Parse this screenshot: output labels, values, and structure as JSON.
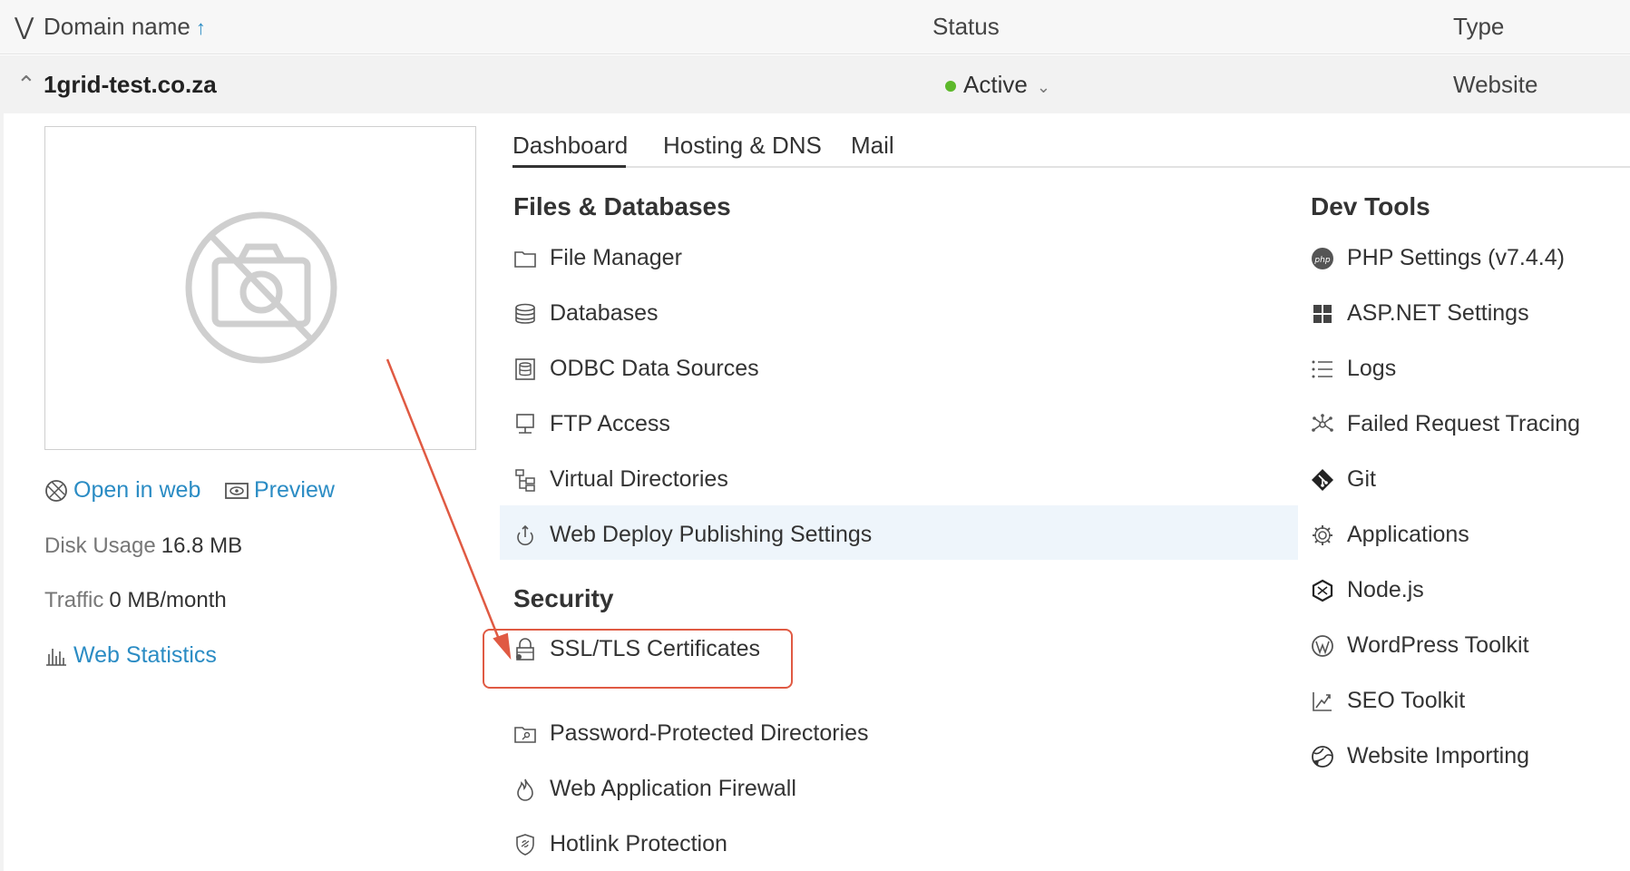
{
  "table_header": {
    "domain_name": "Domain name",
    "sort_icon": "arrow-up-icon",
    "status": "Status",
    "type": "Type"
  },
  "domain": {
    "name": "1grid-test.co.za",
    "status": "Active",
    "status_color": "#5cb82a",
    "type": "Website"
  },
  "left_panel": {
    "open_in_web": "Open in web",
    "preview": "Preview",
    "disk_usage_label": "Disk Usage",
    "disk_usage_value": "16.8 MB",
    "traffic_label": "Traffic",
    "traffic_value": "0 MB/month",
    "web_statistics": "Web Statistics"
  },
  "tabs": [
    {
      "label": "Dashboard",
      "active": true
    },
    {
      "label": "Hosting & DNS",
      "active": false
    },
    {
      "label": "Mail",
      "active": false
    }
  ],
  "files_databases": {
    "title": "Files & Databases",
    "items": [
      {
        "label": "File Manager",
        "icon": "folder-icon"
      },
      {
        "label": "Databases",
        "icon": "database-icon"
      },
      {
        "label": "ODBC Data Sources",
        "icon": "odbc-icon"
      },
      {
        "label": "FTP Access",
        "icon": "ftp-icon"
      },
      {
        "label": "Virtual Directories",
        "icon": "directories-icon"
      },
      {
        "label": "Web Deploy Publishing Settings",
        "icon": "web-deploy-icon"
      }
    ]
  },
  "security": {
    "title": "Security",
    "items": [
      {
        "label": "SSL/TLS Certificates",
        "icon": "lock-icon"
      },
      {
        "label": "Password-Protected Directories",
        "icon": "protected-folder-icon"
      },
      {
        "label": "Web Application Firewall",
        "icon": "fire-icon"
      },
      {
        "label": "Hotlink Protection",
        "icon": "shield-icon"
      }
    ]
  },
  "dev_tools": {
    "title": "Dev Tools",
    "items": [
      {
        "label": "PHP Settings (v7.4.4)",
        "icon": "php-icon"
      },
      {
        "label": "ASP.NET Settings",
        "icon": "windows-icon"
      },
      {
        "label": "Logs",
        "icon": "list-icon"
      },
      {
        "label": "Failed Request Tracing",
        "icon": "network-icon"
      },
      {
        "label": "Git",
        "icon": "git-icon"
      },
      {
        "label": "Applications",
        "icon": "gear-icon"
      },
      {
        "label": "Node.js",
        "icon": "nodejs-icon"
      },
      {
        "label": "WordPress Toolkit",
        "icon": "wordpress-icon"
      },
      {
        "label": "SEO Toolkit",
        "icon": "seo-chart-icon"
      },
      {
        "label": "Website Importing",
        "icon": "globe-import-icon"
      }
    ]
  },
  "colors": {
    "link": "#2b8cc4",
    "annotation": "#e05a43",
    "highlight_row": "#eef5fb"
  }
}
